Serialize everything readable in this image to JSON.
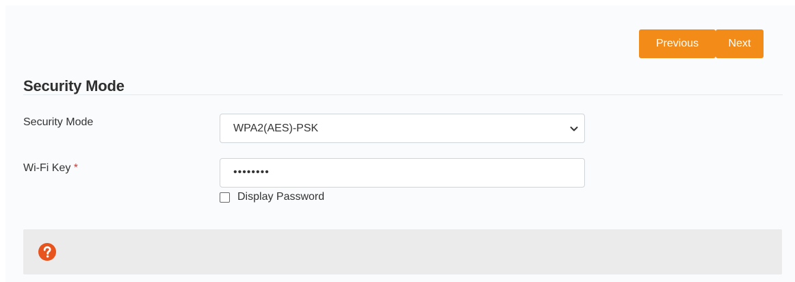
{
  "nav": {
    "previous_label": "Previous",
    "next_label": "Next"
  },
  "section": {
    "title": "Security Mode"
  },
  "fields": {
    "security_mode_label": "Security Mode",
    "security_mode_value": "WPA2(AES)-PSK",
    "wifi_key_label": "Wi-Fi Key",
    "wifi_key_required_mark": "*",
    "wifi_key_value": "••••••••",
    "display_password_label": "Display Password",
    "display_password_checked": false
  },
  "help": {
    "icon": "help-circle-icon"
  },
  "colors": {
    "accent": "#f28b17",
    "required": "#e0322c",
    "panel_bg": "#f9fbfc",
    "help_bg": "#ebebeb",
    "help_icon": "#e8541e"
  }
}
